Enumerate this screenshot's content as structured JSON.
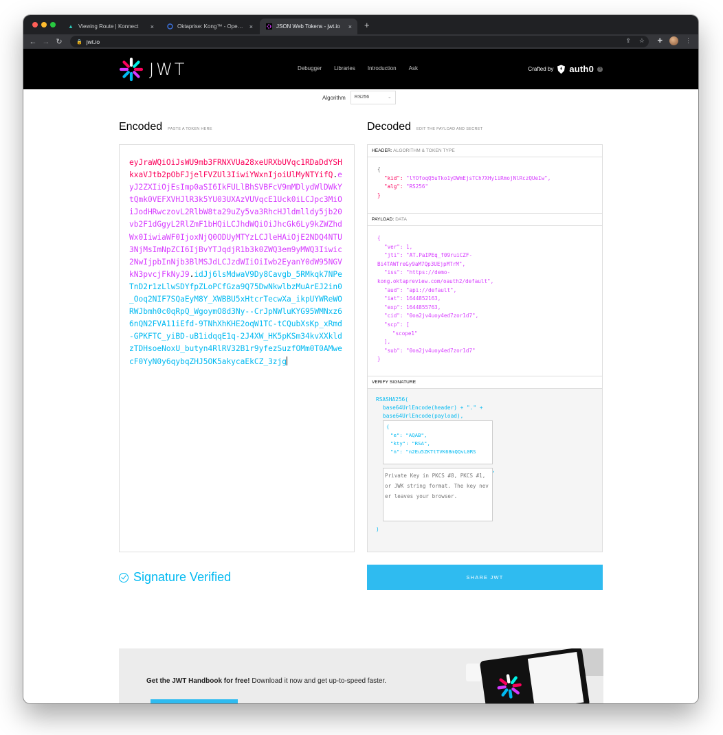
{
  "browser": {
    "tabs": [
      {
        "title": "Viewing Route | Konnect",
        "active": false
      },
      {
        "title": "Oktaprise: Kong™ - OpenID Co",
        "active": false
      },
      {
        "title": "JSON Web Tokens - jwt.io",
        "active": true
      }
    ],
    "new_tab": "+",
    "close_glyph": "×",
    "url": "jwt.io"
  },
  "site": {
    "logo_text": "JWT",
    "nav": [
      "Debugger",
      "Libraries",
      "Introduction",
      "Ask"
    ],
    "crafted_by": "Crafted by",
    "brand": "auth0",
    "help": "?"
  },
  "algorithm": {
    "label": "Algorithm",
    "value": "RS256"
  },
  "encoded": {
    "title": "Encoded",
    "hint": "PASTE A TOKEN HERE",
    "header_part": "eyJraWQiOiJsWU9mb3FRNXVUa28xeURXbUVqc1RDaDdYSHkxaVJtb2pObFJjelFVZUl3IiwiYWxnIjoiUlMyNTYifQ",
    "dot1": ".",
    "payload_part": "eyJ2ZXIiOjEsImp0aSI6IkFULlBhSVBFcV9mMDlydWlDWkYtQmk0VEFXVHJlR3k5YU03UXAzVUVqcE1Uck0iLCJpc3MiOiJodHRwczovL2RlbW8ta29uZy5va3RhcHJldmlldy5jb20vb2F1dGgyL2RlZmF1bHQiLCJhdWQiOiJhcGk6Ly9kZWZhdWx0IiwiaWF0IjoxNjQ0ODUyMTYzLCJleHAiOjE2NDQ4NTU3NjMsImNpZCI6IjBvYTJqdjR1b3k0ZWQ3em9yMWQ3Iiwic2NwIjpbInNjb3BlMSJdLCJzdWIiOiIwb2EyanY0dW95NGVkN3pvcjFkNyJ9",
    "dot2": ".",
    "signature_part": "idJj6lsMdwaV9Dy8Cavgb_5RMkqk7NPeTnD2r1zLlwSDYfpZLoPCfGza9Q75DwNkwlbzMuArEJ2in0_Ooq2NIF7SQaEyM8Y_XWBBU5xHtcrTecwXa_ikpUYWReWORWJbmh0c0qRpQ_WgoymO8d3Ny--CrJpNWluKYG95WMNxz66nQN2FVA11iEfd-9TNhXhKHE2oqW1TC-tCQubXsKp_xRmd-GPKFTC_yiBD-uB1idqqE1q-2J4XW_HK5pKSm34kvXXkldzTDHsoeNoxU_butyn4RlRV32B1r9yfezSuzfOMm0T0AMwecF0YyN0y6qybqZHJ5OK5akycaEkCZ_3zjg"
  },
  "decoded": {
    "title": "Decoded",
    "hint": "EDIT THE PAYLOAD AND SECRET",
    "header_label": "HEADER:",
    "header_sub": "ALGORITHM & TOKEN TYPE",
    "header_json": {
      "open": "{",
      "kid_key": "\"kid\":",
      "kid_val": "\"lYOfoqQ5uTko1yDWmEjsTCh7XHy1iRmojNlRczQUeIw\",",
      "alg_key": "\"alg\":",
      "alg_val": "\"RS256\"",
      "close": "}"
    },
    "payload_label": "PAYLOAD:",
    "payload_sub": "DATA",
    "payload_json": {
      "open": "{",
      "ver_key": "\"ver\":",
      "ver_val": "1,",
      "jti_key": "\"jti\":",
      "jti_val_a": "\"AT.PaIPEq_f09ruiCZF-",
      "jti_val_b": "Bi4TAWTreGy9aM7Qp3UEjpMTrM\",",
      "iss_key": "\"iss\":",
      "iss_val_a": "\"https://demo-",
      "iss_val_b": "kong.oktapreview.com/oauth2/default\",",
      "aud_key": "\"aud\":",
      "aud_val": "\"api://default\",",
      "iat_key": "\"iat\":",
      "iat_val": "1644852163,",
      "exp_key": "\"exp\":",
      "exp_val": "1644855763,",
      "cid_key": "\"cid\":",
      "cid_val": "\"0oa2jv4uoy4ed7zor1d7\",",
      "scp_key": "\"scp\":",
      "scp_open": "[",
      "scp_item": "\"scope1\"",
      "scp_close": "],",
      "sub_key": "\"sub\":",
      "sub_val": "\"0oa2jv4uoy4ed7zor1d7\"",
      "close": "}"
    },
    "verify_label": "VERIFY SIGNATURE",
    "verify": {
      "fn": "RSASHA256(",
      "line1": "base64UrlEncode(header) + \".\" +",
      "line2": "base64UrlEncode(payload),",
      "pub_open": "{",
      "pub_e": "\"e\": \"AQAB\",",
      "pub_kty": "\"kty\": \"RSA\",",
      "pub_n": "\"n\": \"n2Eu5ZKTtTVK68mQQvL0RS",
      "comma": ",",
      "private_placeholder": "Private Key in PKCS #8, PKCS #1, or JWK string format. The key never leaves your browser.",
      "close": ")"
    }
  },
  "status": {
    "text": "Signature Verified"
  },
  "share": {
    "label": "SHARE JWT"
  },
  "banner": {
    "bold": "Get the JWT Handbook for free!",
    "rest": " Download it now and get up-to-speed faster."
  },
  "colors": {
    "header_part": "#fb015b",
    "payload_part": "#d63aff",
    "signature_part": "#00b9f1",
    "share_button": "#2fbbf0"
  }
}
